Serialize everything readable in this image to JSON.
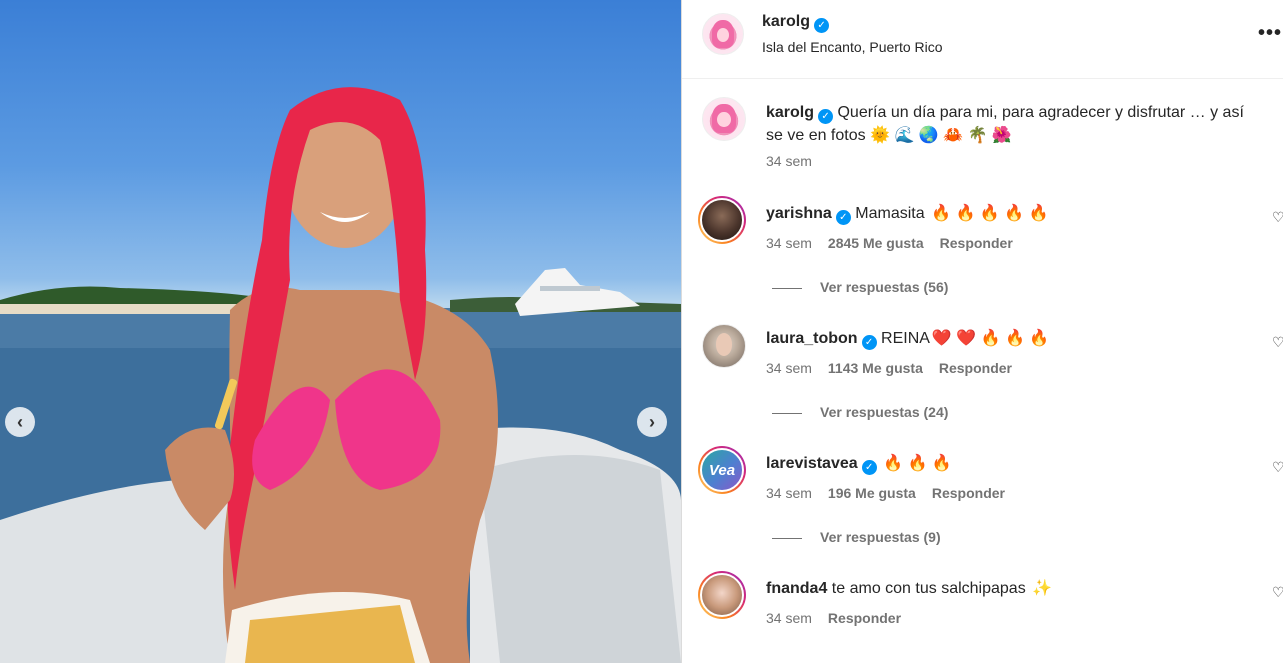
{
  "post": {
    "username": "karolg",
    "location": "Isla del Encanto, Puerto Rico",
    "more_label": "•••",
    "prev_label": "‹",
    "next_label": "›",
    "verified_label": "✓"
  },
  "caption": {
    "username": "karolg",
    "text": "Quería un día para mi, para agradecer y disfrutar … y así se ve en fotos",
    "emojis": "🌞 🌊 🌏 🦀 🌴 🌺",
    "time": "34 sem"
  },
  "comments": [
    {
      "username": "yarishna",
      "text": "Mamasita",
      "emojis": "🔥 🔥 🔥 🔥 🔥",
      "time": "34 sem",
      "likes": "2845 Me gusta",
      "reply": "Responder",
      "replies": "Ver respuestas (56)",
      "verified": true
    },
    {
      "username": "laura_tobon",
      "text": "REINA",
      "emojis": "❤️ ❤️ 🔥 🔥 🔥",
      "time": "34 sem",
      "likes": "1143 Me gusta",
      "reply": "Responder",
      "replies": "Ver respuestas (24)",
      "verified": true
    },
    {
      "username": "larevistavea",
      "text": "",
      "emojis": "🔥 🔥 🔥",
      "time": "34 sem",
      "likes": "196 Me gusta",
      "reply": "Responder",
      "replies": "Ver respuestas (9)",
      "verified": true,
      "avatar_text": "Vea"
    },
    {
      "username": "fnanda4",
      "text": "te amo con tus salchipapas",
      "emojis": "✨",
      "time": "34 sem",
      "likes": "",
      "reply": "Responder",
      "replies": "",
      "verified": false
    }
  ],
  "icons": {
    "heart": "♡"
  },
  "colors": {
    "verified": "#0095f6",
    "hair": "#e8264a",
    "bikini": "#f0358a",
    "sky": "#4a8ede",
    "sea": "#3a6d99"
  }
}
